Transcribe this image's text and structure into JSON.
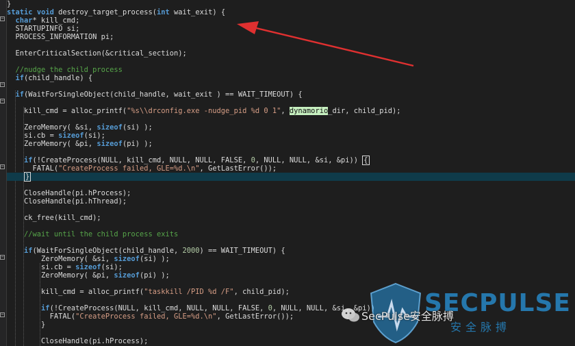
{
  "editor": {
    "tokens": {
      "static": "static",
      "void": "void",
      "char": "char",
      "if": "if",
      "sizeof": "sizeof",
      "int": "int"
    },
    "lines": {
      "l00": "}",
      "l01a": "destroy_target_process(",
      "l01b": " wait_exit) {",
      "l02": "* kill_cmd;",
      "l03": "STARTUPINFO si;",
      "l04": "PROCESS_INFORMATION pi;",
      "l06": "EnterCriticalSection(&critical_section);",
      "l08": "//nudge the child process",
      "l09": "(child_handle) {",
      "l11": "(WaitForSingleObject(child_handle, wait_exit ) == WAIT_TIMEOUT) {",
      "l13a": "kill_cmd = alloc_printf(",
      "l13s": "\"%s\\\\drconfig.exe -nudge_pid %d 0 1\"",
      "l13c": ", ",
      "l13h": "dynamorio",
      "l13d": "_dir, child_pid);",
      "l15a": "ZeroMemory( &si, ",
      "l15b": "(si) );",
      "l16a": "si.cb = ",
      "l16b": "(si);",
      "l17a": "ZeroMemory( &pi, ",
      "l17b": "(pi) );",
      "l19a": "(!CreateProcess(NULL, kill_cmd, NULL, NULL, FALSE, ",
      "l19n": "0",
      "l19b": ", NULL, NULL, &si, &pi)) ",
      "l19c": "{",
      "l20a": "FATAL(",
      "l20s": "\"CreateProcess failed, GLE=%d.\\n\"",
      "l20b": ", GetLastError());",
      "l21": "}",
      "l23": "CloseHandle(pi.hProcess);",
      "l24": "CloseHandle(pi.hThread);",
      "l26": "ck_free(kill_cmd);",
      "l28": "//wait until the child process exits",
      "l30a": "(WaitForSingleObject(child_handle, ",
      "l30n": "2000",
      "l30b": ") == WAIT_TIMEOUT) {",
      "l31a": "ZeroMemory( &si, ",
      "l31b": "(si) );",
      "l32a": "si.cb = ",
      "l32b": "(si);",
      "l33a": "ZeroMemory( &pi, ",
      "l33b": "(pi) );",
      "l35a": "kill_cmd = alloc_printf(",
      "l35s": "\"taskkill /PID %d /F\"",
      "l35b": ", child_pid);",
      "l37a": "(!CreateProcess(NULL, kill_cmd, NULL, NULL, FALSE, ",
      "l37n": "0",
      "l37b": ", NULL, NULL, &si, &pi))",
      "l38a": "FATAL(",
      "l38s": "\"CreateProcess failed, GLE=%d.\\n\"",
      "l38b": ", GetLastError());",
      "l39": "}",
      "l41": "CloseHandle(pi.hProcess);"
    },
    "fold_markers": {
      "minus": "−"
    }
  },
  "annotation": {
    "arrow_color": "#e03030"
  },
  "watermark": {
    "brand": "SECPULSE",
    "subtitle": "安全脉搏",
    "handle": "SecPulse安全脉搏",
    "color": "#2896dc"
  }
}
